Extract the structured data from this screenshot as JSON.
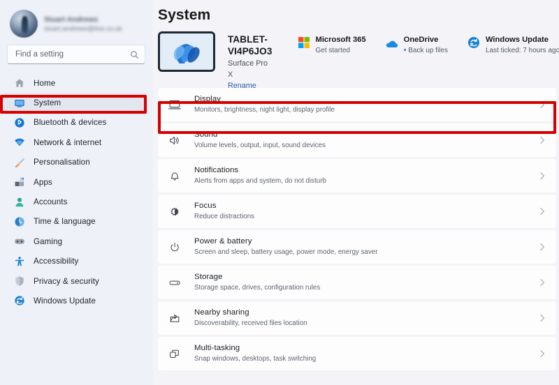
{
  "account": {
    "name": "Stuart Andrews",
    "email": "stuart.andrews@live.co.uk",
    "avatar_icon": "user-avatar-photo"
  },
  "search": {
    "placeholder": "Find a setting",
    "value": "",
    "icon": "search-icon"
  },
  "sidebar": {
    "items": [
      {
        "label": "Home",
        "icon": "home-icon",
        "selected": false
      },
      {
        "label": "System",
        "icon": "monitor-icon",
        "selected": true
      },
      {
        "label": "Bluetooth & devices",
        "icon": "bluetooth-icon",
        "selected": false
      },
      {
        "label": "Network & internet",
        "icon": "wifi-icon",
        "selected": false
      },
      {
        "label": "Personalisation",
        "icon": "paintbrush-icon",
        "selected": false
      },
      {
        "label": "Apps",
        "icon": "apps-icon",
        "selected": false
      },
      {
        "label": "Accounts",
        "icon": "person-icon",
        "selected": false
      },
      {
        "label": "Time & language",
        "icon": "clock-icon",
        "selected": false
      },
      {
        "label": "Gaming",
        "icon": "gamepad-icon",
        "selected": false
      },
      {
        "label": "Accessibility",
        "icon": "accessibility-icon",
        "selected": false
      },
      {
        "label": "Privacy & security",
        "icon": "shield-icon",
        "selected": false
      },
      {
        "label": "Windows Update",
        "icon": "update-icon",
        "selected": false
      }
    ]
  },
  "main": {
    "page_title": "System",
    "device": {
      "name": "TABLET-VI4P6JO3",
      "model": "Surface Pro X",
      "rename_label": "Rename",
      "thumbnail_icon": "tablet-wallpaper-thumbnail"
    },
    "quick_links": [
      {
        "title": "Microsoft 365",
        "subtitle": "Get started",
        "icon": "microsoft-365-icon",
        "bullet": false
      },
      {
        "title": "OneDrive",
        "subtitle": "Back up files",
        "icon": "onedrive-cloud-icon",
        "bullet": true
      },
      {
        "title": "Windows Update",
        "subtitle": "Last ticked: 7 hours ago",
        "icon": "windows-update-icon",
        "bullet": false
      }
    ],
    "settings_rows": [
      {
        "title": "Display",
        "subtitle": "Monitors, brightness, night light, display profile",
        "icon": "display-monitor-icon",
        "highlighted": true
      },
      {
        "title": "Sound",
        "subtitle": "Volume levels, output, input, sound devices",
        "icon": "speaker-icon",
        "highlighted": false
      },
      {
        "title": "Notifications",
        "subtitle": "Alerts from apps and system, do not disturb",
        "icon": "bell-icon",
        "highlighted": false
      },
      {
        "title": "Focus",
        "subtitle": "Reduce distractions",
        "icon": "focus-moon-icon",
        "highlighted": false
      },
      {
        "title": "Power & battery",
        "subtitle": "Screen and sleep, battery usage, power mode, energy saver",
        "icon": "power-icon",
        "highlighted": false
      },
      {
        "title": "Storage",
        "subtitle": "Storage space, drives, configuration rules",
        "icon": "storage-drive-icon",
        "highlighted": false
      },
      {
        "title": "Nearby sharing",
        "subtitle": "Discoverability, received files location",
        "icon": "share-icon",
        "highlighted": false
      },
      {
        "title": "Multi-tasking",
        "subtitle": "Snap windows, desktops, task switching",
        "icon": "windows-stack-icon",
        "highlighted": false
      }
    ],
    "chevron_icon": "chevron-right-icon"
  },
  "annotations": {
    "highlight_color": "#d70000",
    "boxes": [
      {
        "name": "sidebar-system-highlight",
        "target": "System"
      },
      {
        "name": "display-row-highlight",
        "target": "Display"
      }
    ]
  },
  "colors": {
    "accent": "#5b5fc7",
    "link": "#2f5fa8",
    "sidebar_bg": "#eef1f7",
    "page_bg": "#f3f3f8",
    "card_bg": "#fdfdfe"
  }
}
